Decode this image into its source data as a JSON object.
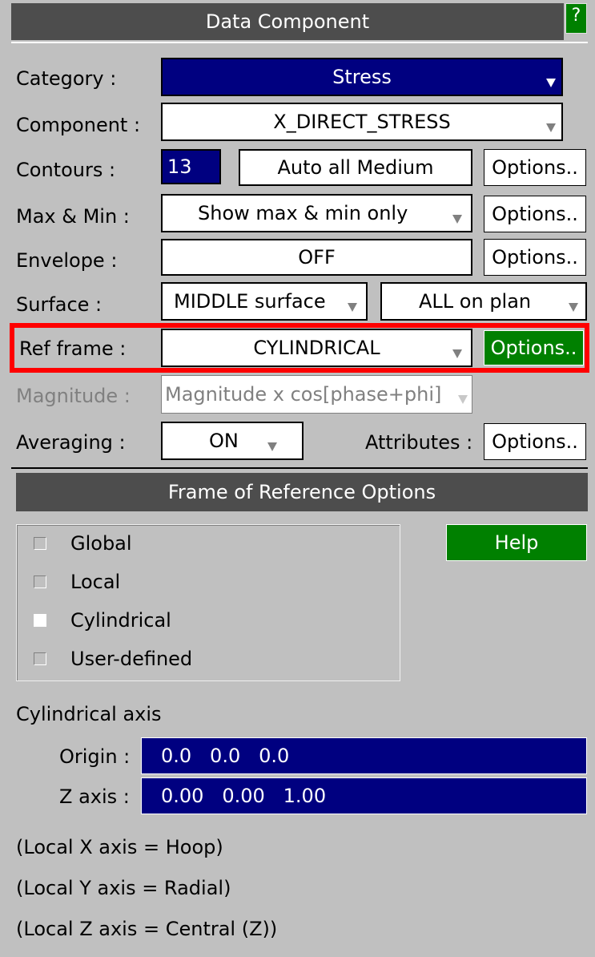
{
  "window": {
    "title": "Data Component",
    "help_glyph": "?"
  },
  "rows": {
    "category": {
      "label": "Category :",
      "value": "Stress"
    },
    "component": {
      "label": "Component :",
      "value": "X_DIRECT_STRESS"
    },
    "contours": {
      "label": "Contours :",
      "count": "13",
      "mode": "Auto all Medium",
      "options": "Options.."
    },
    "maxmin": {
      "label": "Max & Min :",
      "value": "Show max & min only",
      "options": "Options.."
    },
    "envelope": {
      "label": "Envelope :",
      "value": "OFF",
      "options": "Options.."
    },
    "surface": {
      "label": "Surface :",
      "surface": "MIDDLE surface",
      "plan": "ALL on plan"
    },
    "ref_frame": {
      "label": "Ref frame :",
      "value": "CYLINDRICAL",
      "options": "Options.."
    },
    "magnitude": {
      "label": "Magnitude :",
      "value": "Magnitude x cos[phase+phi]"
    },
    "averaging": {
      "label": "Averaging :",
      "value": "ON",
      "attributes_label": "Attributes :",
      "options": "Options.."
    }
  },
  "frame_options": {
    "title": "Frame of Reference Options",
    "help": "Help",
    "choices": [
      {
        "label": "Global",
        "checked": false
      },
      {
        "label": "Local",
        "checked": false
      },
      {
        "label": "Cylindrical",
        "checked": true
      },
      {
        "label": "User-defined",
        "checked": false
      }
    ],
    "axis_heading": "Cylindrical axis",
    "origin_label": "Origin :",
    "origin_value": "0.0   0.0   0.0",
    "zaxis_label": "Z axis :",
    "zaxis_value": "0.00   0.00   1.00",
    "notes": [
      "(Local X axis = Hoop)",
      "(Local Y axis = Radial)",
      "(Local Z axis = Central (Z))"
    ]
  },
  "colors": {
    "panel": "#c0c0c0",
    "title_bar": "#4d4d4d",
    "navy": "#000080",
    "green": "#008000",
    "highlight": "#ff0000"
  },
  "icons": {
    "dropdown": "dropdown-arrow-icon",
    "checkbox": "checkbox-icon"
  }
}
